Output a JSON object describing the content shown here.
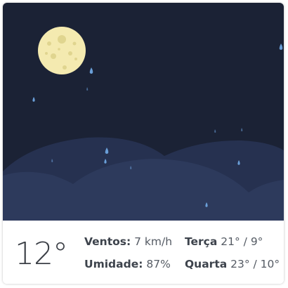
{
  "weather": {
    "temperature": "12°",
    "stats": [
      {
        "label": "Ventos:",
        "value": "7 km/h"
      },
      {
        "label": "Umidade:",
        "value": "87%"
      }
    ],
    "forecast": [
      {
        "day": "Terça",
        "range": "21° / 9°"
      },
      {
        "day": "Quarta",
        "range": "23° / 10°"
      }
    ]
  },
  "colors": {
    "sky": "#1b2235",
    "hills_back": "#263150",
    "hills_front": "#2d3a5c",
    "moon": "#f4eab0",
    "rain": "#6a9fd8"
  },
  "icons": {
    "moon": "full-moon-icon",
    "rain": "raindrop-icon"
  }
}
